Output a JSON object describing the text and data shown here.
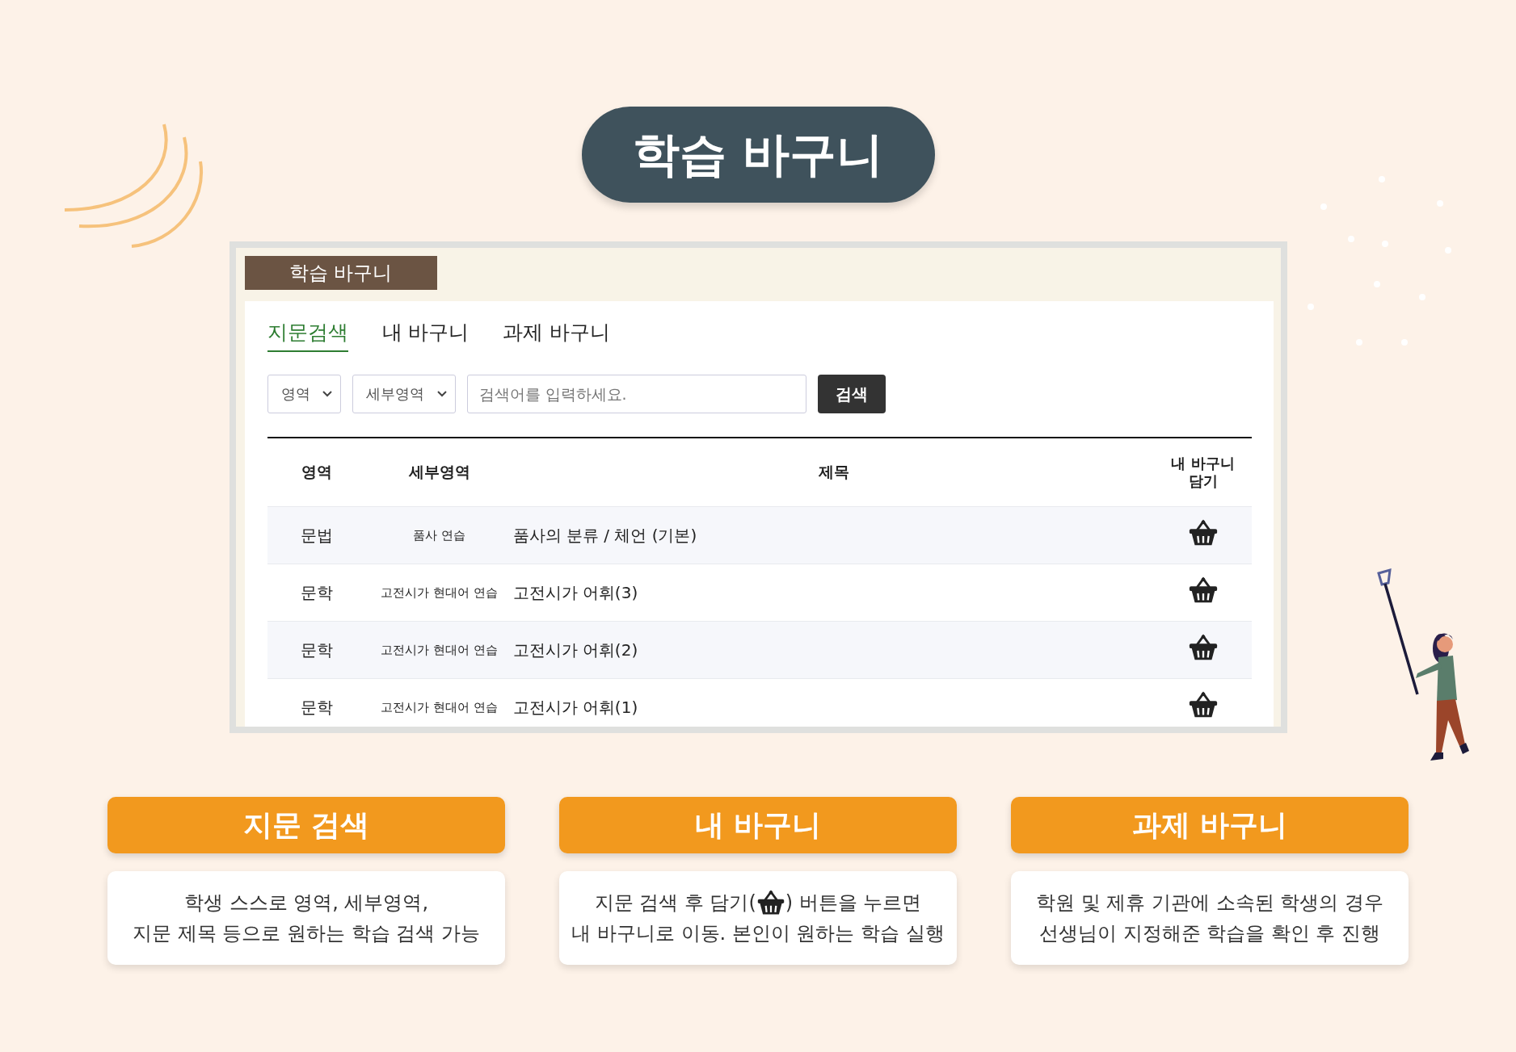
{
  "headline": "학습 바구니",
  "panel": {
    "label": "학습 바구니",
    "tabs": [
      {
        "label": "지문검색",
        "selected": true
      },
      {
        "label": "내 바구니",
        "selected": false
      },
      {
        "label": "과제 바구니",
        "selected": false
      }
    ],
    "selects": [
      {
        "label": "영역"
      },
      {
        "label": "세부영역"
      }
    ],
    "search": {
      "placeholder": "검색어를 입력하세요."
    },
    "search_button": "검색",
    "table": {
      "columns": [
        "영역",
        "세부영역",
        "제목",
        "내 바구니 담기"
      ],
      "rows": [
        {
          "area": "문법",
          "subarea": "품사 연습",
          "title": "품사의 분류 / 체언 (기본)"
        },
        {
          "area": "문학",
          "subarea": "고전시가 현대어 연습",
          "title": "고전시가 어휘(3)"
        },
        {
          "area": "문학",
          "subarea": "고전시가 현대어 연습",
          "title": "고전시가 어휘(2)"
        },
        {
          "area": "문학",
          "subarea": "고전시가 현대어 연습",
          "title": "고전시가 어휘(1)"
        }
      ]
    }
  },
  "features": [
    {
      "title": "지문 검색",
      "lines": [
        [
          {
            "kind": "text",
            "text": "학생 스스로 영역, 세부영역,"
          }
        ],
        [
          {
            "kind": "text",
            "text": "지문 제목 등으로 원하는 학습 검색 가능"
          }
        ]
      ]
    },
    {
      "title": "내 바구니",
      "lines": [
        [
          {
            "kind": "text",
            "text": "지문 검색 후 담기("
          },
          {
            "kind": "basket"
          },
          {
            "kind": "text",
            "text": ") 버튼을 누르면"
          }
        ],
        [
          {
            "kind": "text",
            "text": "내 바구니로 이동. 본인이 원하는 학습 실행"
          }
        ]
      ]
    },
    {
      "title": "과제 바구니",
      "lines": [
        [
          {
            "kind": "text",
            "text": "학원 및 제휴 기관에 소속된 학생의 경우"
          }
        ],
        [
          {
            "kind": "text",
            "text": "선생님이 지정해준 학습을 확인 후 진행"
          }
        ]
      ]
    }
  ]
}
